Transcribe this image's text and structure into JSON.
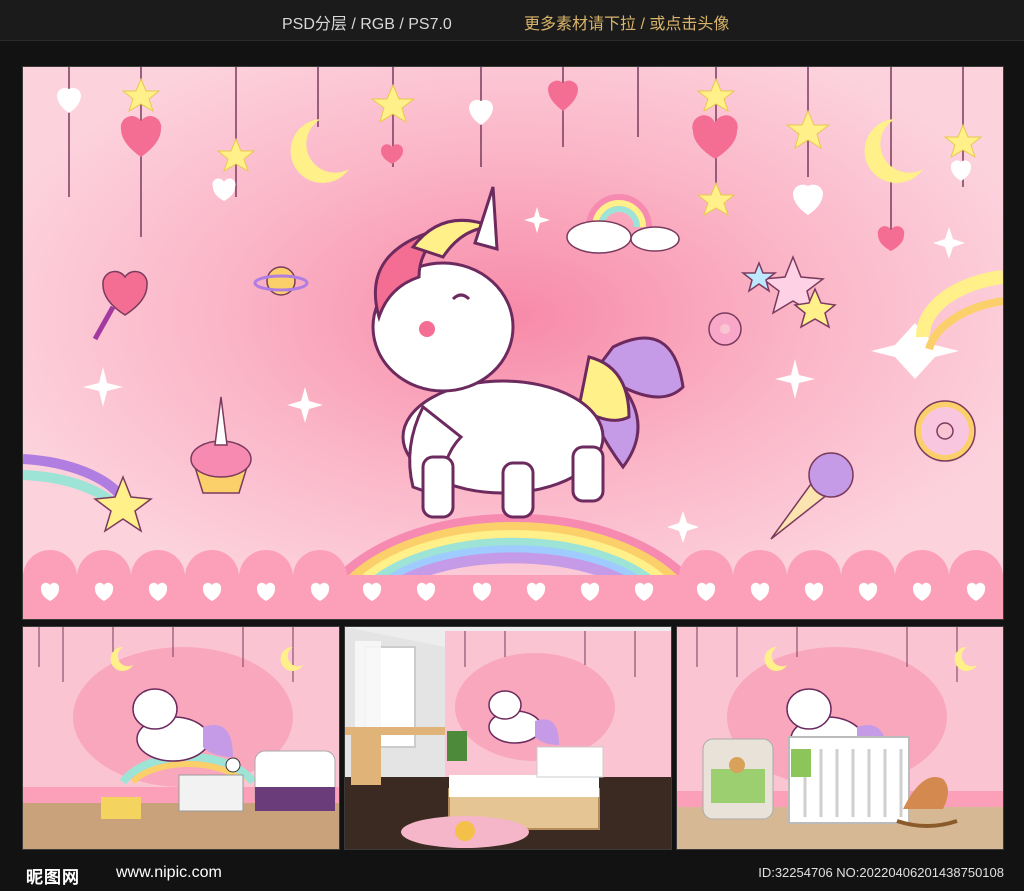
{
  "header": {
    "format": "PSD分层 / RGB / PS7.0",
    "more_link": "更多素材请下拉 / 或点击头像"
  },
  "footer": {
    "logo": "昵图网",
    "site": "www.nipic.com",
    "id_text": "ID:32254706 NO:20220406201438750108"
  },
  "colors": {
    "background": "#121212",
    "wall_pink": "#fbc4d2",
    "accent_gold": "#d9b46a",
    "heart_pink": "#f78aa5",
    "star_yellow": "#fff08a"
  },
  "previews": [
    {
      "name": "main-wallpaper"
    },
    {
      "name": "kids-room-toys"
    },
    {
      "name": "bedroom-with-window"
    },
    {
      "name": "nursery-with-crib"
    }
  ]
}
